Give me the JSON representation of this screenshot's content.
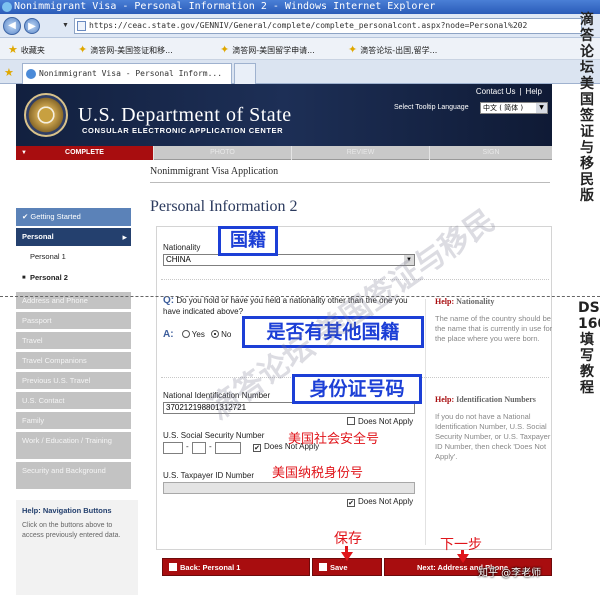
{
  "browser": {
    "title": "Nonimmigrant Visa - Personal Information 2 - Windows Internet Explorer",
    "url": "https://ceac.state.gov/GENNIV/General/complete/complete_personalcont.aspx?node=Personal%202",
    "favorites_label": "收藏夹",
    "favorites": [
      "滴答网-美国签证和移...",
      "滴答网-美国留学申请...",
      "滴答论坛-出国,留学..."
    ],
    "tab_title": "Nonimmigrant Visa - Personal Inform..."
  },
  "header": {
    "contact_us": "Contact Us",
    "help": "Help",
    "department": "U.S. Department of State",
    "subtitle": "CONSULAR ELECTRONIC APPLICATION CENTER",
    "tooltip_language_label": "Select Tooltip Language",
    "tooltip_language_value": "中文 ( 简体 )"
  },
  "progress": {
    "steps": [
      "COMPLETE",
      "PHOTO",
      "REVIEW",
      "SIGN"
    ],
    "active": "COMPLETE"
  },
  "sidebar": {
    "getting_started": "✔ Getting Started",
    "personal": "Personal",
    "personal_1": "Personal 1",
    "personal_2": "Personal 2",
    "disabled_items": [
      "Address and Phone",
      "Passport",
      "Travel",
      "Travel Companions",
      "Previous U.S. Travel",
      "U.S. Contact",
      "Family",
      "Work / Education / Training",
      "Security and Background"
    ],
    "help_title": "Help: Navigation Buttons",
    "help_text": "Click on the buttons above to access previously entered data."
  },
  "main": {
    "breadcrumb": "Nonimmigrant Visa Application",
    "page_title": "Personal Information 2",
    "nationality_label": "Nationality",
    "nationality_value": "CHINA",
    "other_nationality_q_prefix": "Q:",
    "other_nationality_question": "Do you hold or have you held a nationality other than the one you have indicated above?",
    "answer_prefix": "A:",
    "yes_label": "Yes",
    "no_label": "No",
    "national_id_label": "National Identification Number",
    "national_id_value": "370212198801312721",
    "does_not_apply": "Does Not Apply",
    "ssn_label": "U.S. Social Security Number",
    "taxpayer_label": "U.S. Taxpayer ID Number",
    "help_nationality_title_prefix": "Help:",
    "help_nationality_title": "Nationality",
    "help_nationality_text": "The name of the country should be the name that is currently in use for the place where you were born.",
    "help_nid_title_prefix": "Help:",
    "help_nid_title": "Identification Numbers",
    "help_nid_text": "If you do not have a National Identification Number, U.S. Social Security Number, or U.S. Taxpayer ID Number, then check 'Does Not Apply'."
  },
  "buttons": {
    "back": "Back: Personal 1",
    "save": "Save",
    "next": "Next: Address and Phone"
  },
  "annotations": {
    "nationality": "国籍",
    "other_nationality": "是否有其他国籍",
    "national_id": "身份证号码",
    "ssn": "美国社会安全号",
    "taxpayer": "美国纳税身份号",
    "save": "保存",
    "next": "下一步",
    "side_top": "滴答论坛 美国签证与移民版",
    "side_bottom": "DS-160填写教程",
    "watermark": "滴答论坛 美国签证与移民",
    "credit": "知乎 @李老师"
  },
  "colors": {
    "accent_red": "#a80d0f",
    "navy": "#24406e",
    "annotation_blue": "#1c3fd6",
    "annotation_red": "#e0151b"
  }
}
